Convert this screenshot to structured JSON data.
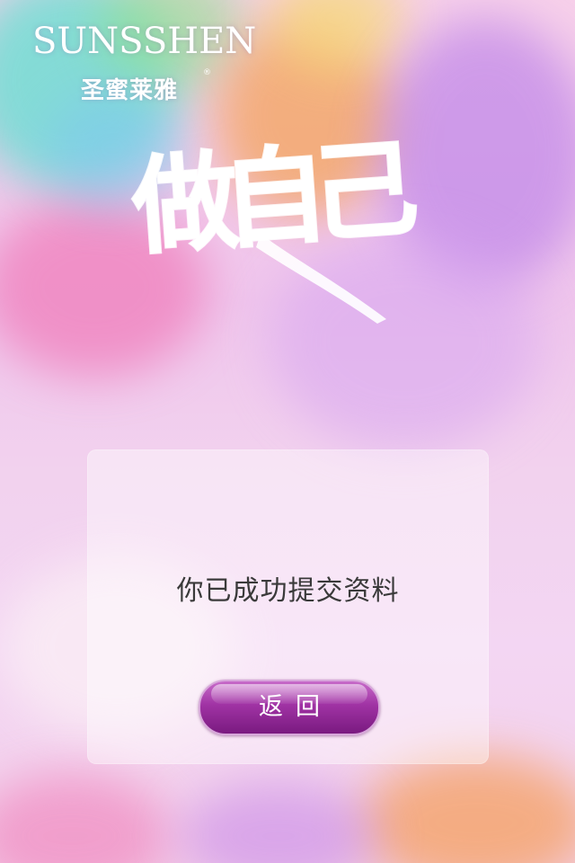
{
  "brand": {
    "name_en": "SUNSSHEN",
    "name_cn": "圣蜜莱雅",
    "registered_mark": "®"
  },
  "headline": {
    "text": "做自己"
  },
  "dialog": {
    "message": "你已成功提交资料",
    "back_button_label": "返回"
  },
  "colors": {
    "button_purple": "#a033a4",
    "message_text": "#3a3a3a",
    "brand_text": "#ffffff"
  }
}
